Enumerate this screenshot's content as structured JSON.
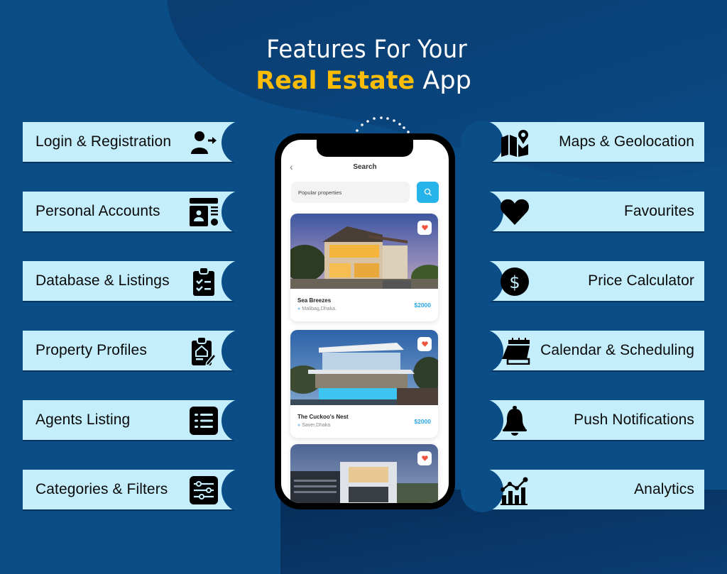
{
  "title": {
    "line1": "Features For Your",
    "accent": "Real Estate",
    "rest": "App"
  },
  "colors": {
    "background": "#0b4d87",
    "background_dark": "#07335f",
    "banner": "#c5eefc",
    "accent_yellow": "#fbbc05",
    "search_button": "#25b3ea",
    "price": "#29a7e8",
    "favorite_heart": "#f0533f"
  },
  "features_left": [
    {
      "label": "Login & Registration",
      "icon": "user-login-icon"
    },
    {
      "label": "Personal Accounts",
      "icon": "account-card-icon"
    },
    {
      "label": "Database & Listings",
      "icon": "clipboard-checklist-icon"
    },
    {
      "label": "Property Profiles",
      "icon": "clipboard-house-icon"
    },
    {
      "label": "Agents Listing",
      "icon": "list-icon"
    },
    {
      "label": "Categories & Filters",
      "icon": "sliders-icon"
    }
  ],
  "features_right": [
    {
      "label": "Maps & Geolocation",
      "icon": "map-pin-icon"
    },
    {
      "label": "Favourites",
      "icon": "heart-icon"
    },
    {
      "label": "Price Calculator",
      "icon": "dollar-circle-icon"
    },
    {
      "label": "Calendar & Scheduling",
      "icon": "calendar-icon"
    },
    {
      "label": "Push Notifications",
      "icon": "bell-icon"
    },
    {
      "label": "Analytics",
      "icon": "chart-icon"
    }
  ],
  "phone": {
    "screen_title": "Search",
    "back_glyph": "‹",
    "search_value": "Popular properties",
    "listings": [
      {
        "name": "Sea Breezes",
        "location": "Malibag,Dhaka.",
        "price": "$2000"
      },
      {
        "name": "The Cuckoo's Nest",
        "location": "Saver,Dhaka",
        "price": "$2000"
      },
      {
        "name": "",
        "location": "",
        "price": ""
      }
    ]
  }
}
